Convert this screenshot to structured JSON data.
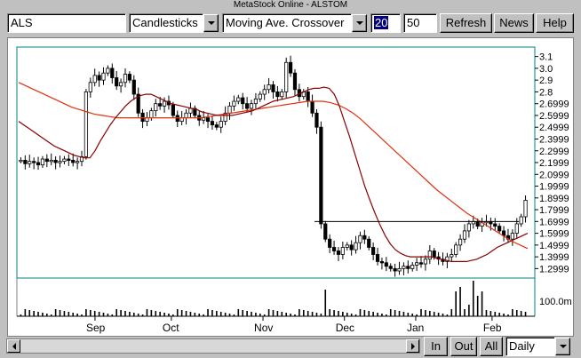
{
  "window": {
    "title": "MetaStock Online - ALSTOM"
  },
  "toolbar": {
    "symbol": "ALS",
    "chart_type": "Candlesticks",
    "indicator": "Moving Ave. Crossover",
    "param1": "20",
    "param2": "50",
    "refresh_label": "Refresh",
    "news_label": "News",
    "help_label": "Help"
  },
  "bottom": {
    "in_label": "In",
    "out_label": "Out",
    "all_label": "All",
    "period": "Daily"
  },
  "colors": {
    "ma_fast": "#8b0000",
    "ma_slow": "#e03010",
    "candle": "#000000",
    "panel_border": "#008080"
  },
  "chart_data": {
    "type": "candlestick",
    "y_ticks": [
      "3.1",
      "3.0",
      "2.9",
      "2.8",
      "2.6999",
      "2.5999",
      "2.4999",
      "2.3999",
      "2.2999",
      "2.1999",
      "2.0999",
      "1.9999",
      "1.8999",
      "1.7999",
      "1.6999",
      "1.5999",
      "1.4999",
      "1.3999",
      "1.2999"
    ],
    "y_range": [
      1.25,
      3.15
    ],
    "x_labels": [
      "Sep",
      "Oct",
      "Nov",
      "Dec",
      "Jan",
      "Feb"
    ],
    "volume_tick": "100.0m",
    "horizontal_line": 1.7,
    "close_series": [
      2.22,
      2.19,
      2.21,
      2.2,
      2.18,
      2.23,
      2.21,
      2.22,
      2.2,
      2.21,
      2.23,
      2.22,
      2.2,
      2.21,
      2.25,
      2.8,
      2.88,
      2.94,
      2.9,
      2.96,
      3.0,
      2.92,
      2.85,
      2.88,
      2.95,
      2.9,
      2.78,
      2.62,
      2.55,
      2.58,
      2.64,
      2.7,
      2.68,
      2.72,
      2.69,
      2.6,
      2.55,
      2.58,
      2.62,
      2.66,
      2.6,
      2.56,
      2.58,
      2.55,
      2.52,
      2.5,
      2.55,
      2.62,
      2.68,
      2.72,
      2.75,
      2.7,
      2.66,
      2.7,
      2.74,
      2.78,
      2.82,
      2.86,
      2.8,
      2.76,
      2.8,
      3.05,
      2.96,
      2.82,
      2.76,
      2.8,
      2.72,
      2.62,
      2.5,
      1.68,
      1.55,
      1.48,
      1.45,
      1.42,
      1.48,
      1.5,
      1.46,
      1.52,
      1.58,
      1.55,
      1.48,
      1.42,
      1.36,
      1.35,
      1.32,
      1.3,
      1.28,
      1.3,
      1.32,
      1.3,
      1.33,
      1.35,
      1.34,
      1.38,
      1.45,
      1.4,
      1.38,
      1.36,
      1.4,
      1.42,
      1.5,
      1.55,
      1.62,
      1.68,
      1.7,
      1.66,
      1.69,
      1.7,
      1.68,
      1.66,
      1.62,
      1.58,
      1.55,
      1.6,
      1.68,
      1.74,
      1.88
    ],
    "ma_fast": [
      2.55,
      2.52,
      2.49,
      2.46,
      2.43,
      2.4,
      2.37,
      2.34,
      2.32,
      2.3,
      2.28,
      2.26,
      2.25,
      2.24,
      2.24,
      2.3,
      2.38,
      2.45,
      2.52,
      2.58,
      2.63,
      2.68,
      2.72,
      2.75,
      2.77,
      2.78,
      2.78,
      2.76,
      2.74,
      2.72,
      2.7,
      2.69,
      2.68,
      2.67,
      2.66,
      2.65,
      2.63,
      2.62,
      2.61,
      2.6,
      2.6,
      2.6,
      2.6,
      2.61,
      2.62,
      2.63,
      2.64,
      2.66,
      2.68,
      2.7,
      2.72,
      2.73,
      2.74,
      2.75,
      2.76,
      2.78,
      2.8,
      2.82,
      2.83,
      2.83,
      2.84,
      2.83,
      2.78,
      2.68,
      2.55,
      2.42,
      2.28,
      2.14,
      2.0,
      1.88,
      1.77,
      1.67,
      1.58,
      1.51,
      1.46,
      1.43,
      1.41,
      1.4,
      1.4,
      1.4,
      1.4,
      1.4,
      1.39,
      1.38,
      1.37,
      1.36,
      1.36,
      1.36,
      1.36,
      1.37,
      1.38,
      1.4,
      1.42,
      1.45,
      1.48,
      1.5,
      1.52,
      1.54,
      1.56,
      1.58,
      1.6
    ],
    "ma_slow": [
      2.88,
      2.85,
      2.82,
      2.79,
      2.76,
      2.73,
      2.7,
      2.67,
      2.65,
      2.63,
      2.61,
      2.6,
      2.59,
      2.58,
      2.58,
      2.58,
      2.58,
      2.58,
      2.58,
      2.58,
      2.58,
      2.58,
      2.58,
      2.58,
      2.58,
      2.59,
      2.6,
      2.61,
      2.62,
      2.63,
      2.64,
      2.65,
      2.66,
      2.67,
      2.68,
      2.69,
      2.7,
      2.71,
      2.72,
      2.72,
      2.72,
      2.71,
      2.69,
      2.66,
      2.62,
      2.57,
      2.51,
      2.45,
      2.39,
      2.33,
      2.27,
      2.21,
      2.15,
      2.09,
      2.03,
      1.97,
      1.92,
      1.87,
      1.82,
      1.77,
      1.73,
      1.69,
      1.65,
      1.61,
      1.57,
      1.53,
      1.5,
      1.47
    ]
  }
}
